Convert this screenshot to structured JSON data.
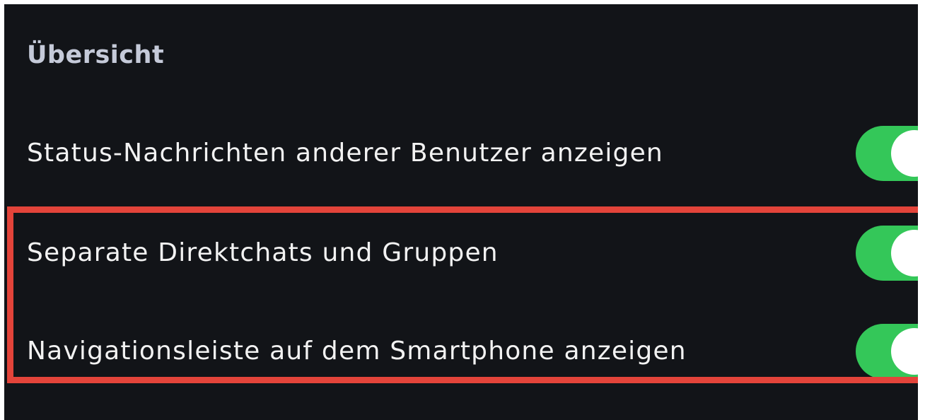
{
  "section": {
    "title": "Übersicht"
  },
  "settings": [
    {
      "label": "Status-Nachrichten anderer Benutzer anzeigen",
      "enabled": true
    },
    {
      "label": "Separate Direktchats und Gruppen",
      "enabled": true
    },
    {
      "label": "Navigationsleiste auf dem Smartphone anzeigen",
      "enabled": true
    }
  ],
  "colors": {
    "background": "#121418",
    "toggle_on": "#34c759",
    "title_text": "#c5cad9",
    "label_text": "#f2f2f2",
    "highlight": "#e3443a"
  }
}
